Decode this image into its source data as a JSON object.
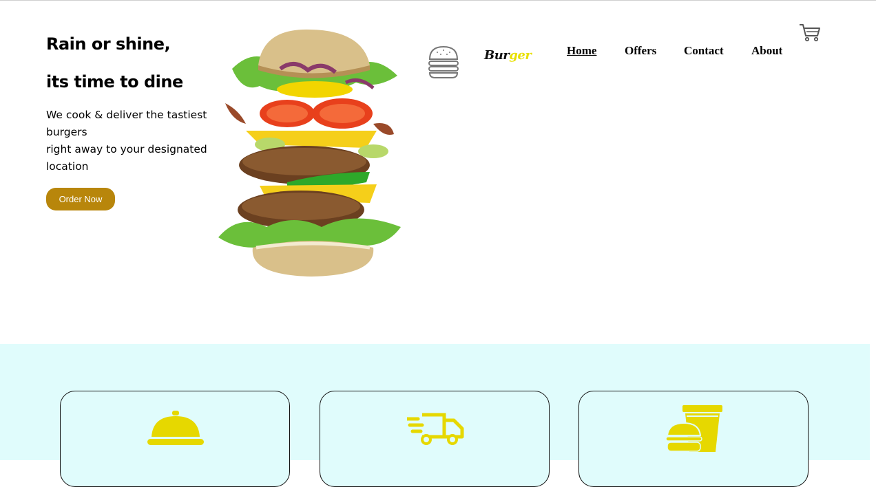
{
  "hero": {
    "title_line1": "Rain or shine,",
    "title_line2": "its time to dine",
    "description_line1": "We cook & deliver the tastiest burgers",
    "description_line2": "right away to your designated location",
    "order_button": "Order Now"
  },
  "header": {
    "brand_part1": "Bur",
    "brand_part2": "ger",
    "nav": [
      {
        "label": "Home",
        "active": true
      },
      {
        "label": "Offers",
        "active": false
      },
      {
        "label": "Contact",
        "active": false
      },
      {
        "label": "About",
        "active": false
      }
    ],
    "cart_icon": "cart-icon",
    "logo_icon": "burger-outline-icon"
  },
  "services": {
    "cards": [
      {
        "icon": "serving-cloche-icon"
      },
      {
        "icon": "delivery-truck-icon"
      },
      {
        "icon": "burger-drink-combo-icon"
      }
    ]
  },
  "colors": {
    "accent": "#b8860b",
    "brand_yellow": "#e8e000",
    "icon_yellow": "#e6d800",
    "band_background": "#e0fcfc"
  }
}
